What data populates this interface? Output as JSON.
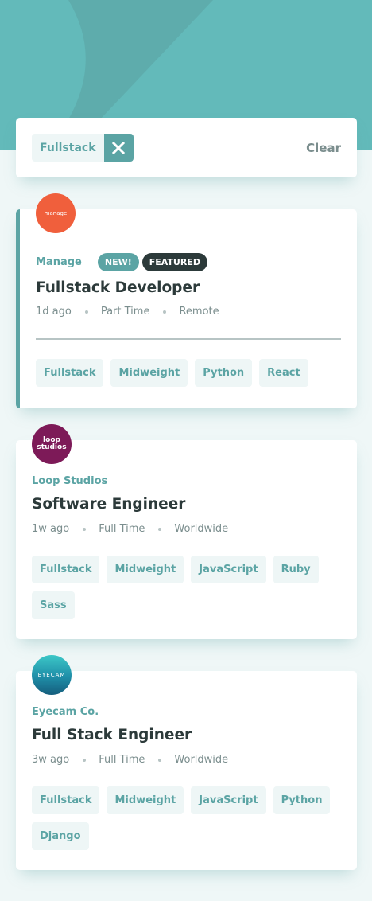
{
  "theme": {
    "header_color": "#63baba",
    "header_shape_color": "#5ba4a4",
    "primary": "#5ba4a4",
    "dark": "#2c3a3a",
    "muted": "#7b8e8e",
    "background": "#eff7f7"
  },
  "filter_bar": {
    "active_filters": [
      "Fullstack"
    ],
    "remove_icon": "close-icon",
    "clear_label": "Clear"
  },
  "jobs": [
    {
      "company": "Manage",
      "logo": {
        "text": "manage",
        "color": "#f05f3c"
      },
      "badges": {
        "new": "NEW!",
        "featured": "FEATURED"
      },
      "position": "Fullstack Developer",
      "posted": "1d ago",
      "contract": "Part Time",
      "location": "Remote",
      "tags": [
        "Fullstack",
        "Midweight",
        "Python",
        "React"
      ],
      "is_featured": true
    },
    {
      "company": "Loop Studios",
      "logo": {
        "text": "loop studios",
        "color": "#7d1a58"
      },
      "position": "Software Engineer",
      "posted": "1w ago",
      "contract": "Full Time",
      "location": "Worldwide",
      "tags": [
        "Fullstack",
        "Midweight",
        "JavaScript",
        "Ruby",
        "Sass"
      ],
      "is_featured": false
    },
    {
      "company": "Eyecam Co.",
      "logo": {
        "text": "EYECAM",
        "color": "#1f8ea8"
      },
      "position": "Full Stack Engineer",
      "posted": "3w ago",
      "contract": "Full Time",
      "location": "Worldwide",
      "tags": [
        "Fullstack",
        "Midweight",
        "JavaScript",
        "Python",
        "Django"
      ],
      "is_featured": false
    }
  ]
}
